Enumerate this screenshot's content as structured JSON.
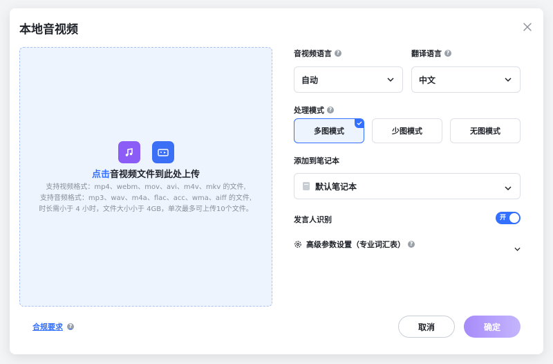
{
  "dialog": {
    "title": "本地音视频"
  },
  "dropzone": {
    "highlight": "点击",
    "main_text": "音视频文件到此处上传",
    "desc_line1": "支持视频格式：mp4、webm、mov、avi、m4v、mkv 的文件,",
    "desc_line2": "支持音频格式：mp3、wav、m4a、flac、acc、wma、aiff 的文件,",
    "desc_line3": "时长需小于 4 小时，文件大小小于 4GB，单次最多可上传10个文件。"
  },
  "settings": {
    "audio_lang_label": "音视频语言",
    "audio_lang_value": "自动",
    "translate_lang_label": "翻译语言",
    "translate_lang_value": "中文",
    "mode_label": "处理模式",
    "modes": [
      "多图模式",
      "少图模式",
      "无图模式"
    ],
    "active_mode": "多图模式",
    "notebook_label": "添加到笔记本",
    "notebook_value": "默认笔记本",
    "speaker_label": "发言人识别",
    "speaker_toggle": "开",
    "speaker_enabled": true,
    "advanced_label": "高级参数设置（专业词汇表）"
  },
  "footer": {
    "compliance": "合规要求",
    "cancel": "取消",
    "confirm": "确定"
  },
  "colors": {
    "accent": "#3370ff",
    "music_icon": "#8b5cf6",
    "video_icon": "#3b6ff6",
    "confirm_gradient": "#a78bfa"
  }
}
